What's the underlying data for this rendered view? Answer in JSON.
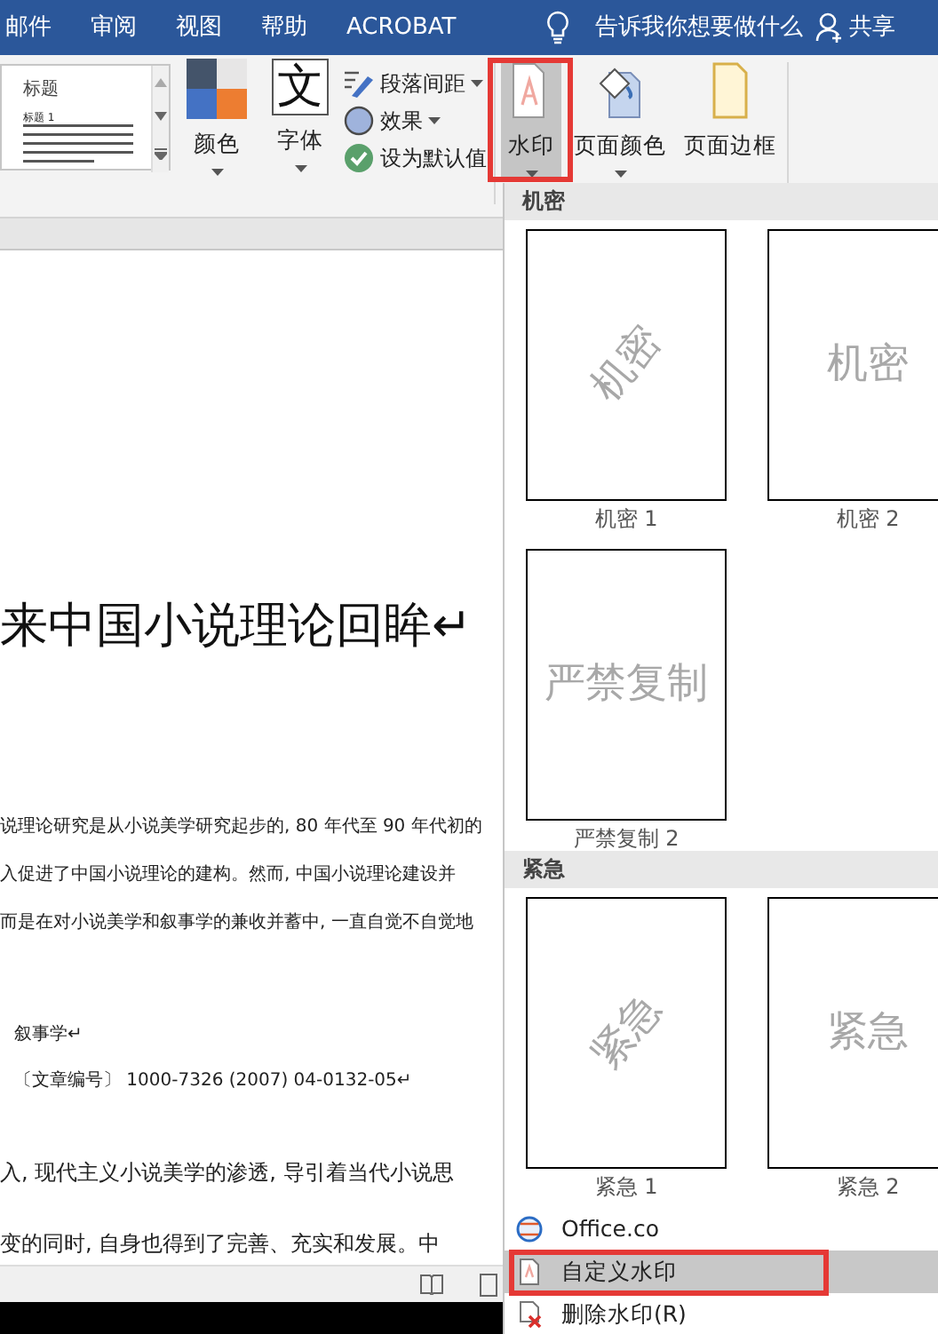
{
  "tabs": [
    {
      "label": "邮件"
    },
    {
      "label": "审阅"
    },
    {
      "label": "视图"
    },
    {
      "label": "帮助"
    },
    {
      "label": "ACROBAT"
    }
  ],
  "tell_me": "告诉我你想要做什么",
  "share": "共享",
  "styles_gallery": {
    "title": "标题",
    "subtitle": "标题 1"
  },
  "design_buttons": [
    {
      "label": "颜色",
      "kind": "colors"
    },
    {
      "label": "字体",
      "kind": "fonts",
      "glyph": "文"
    }
  ],
  "format_options": [
    {
      "label": "段落间距",
      "kind": "spacing",
      "dropdown": true
    },
    {
      "label": "效果",
      "kind": "effects",
      "dropdown": true
    },
    {
      "label": "设为默认值",
      "kind": "default",
      "dropdown": false
    }
  ],
  "page_background": [
    {
      "label": "水印",
      "kind": "watermark",
      "dropdown": true,
      "selected": true
    },
    {
      "label": "页面颜色",
      "kind": "page-color",
      "dropdown": true,
      "selected": false
    },
    {
      "label": "页面边框",
      "kind": "page-border",
      "dropdown": false,
      "selected": false
    }
  ],
  "document": {
    "title": "来中国小说理论回眸↵",
    "paragraph_lines": [
      "说理论研究是从小说美学研究起步的, 80 年代至 90 年代初的",
      "入促进了中国小说理论的建构。然而, 中国小说理论建设并",
      "而是在对小说美学和叙事学的兼收并蓄中, 一直自觉不自觉地"
    ],
    "keywords": "叙事学↵",
    "article_number": "〔文章编号〕 1000-7326 (2007) 04-0132-05↵",
    "body_lines": [
      "入, 现代主义小说美学的渗透, 导引着当代小说思",
      "变的同时, 自身也得到了完善、充实和发展。中"
    ]
  },
  "watermark_menu": {
    "sections": [
      {
        "heading": "机密",
        "items": [
          {
            "label": "机密 1",
            "text": "机密",
            "rotated": true
          },
          {
            "label": "机密 2",
            "text": "机密",
            "rotated": false
          },
          {
            "label": "严禁复制 2",
            "text": "严禁复制",
            "rotated": false
          }
        ]
      },
      {
        "heading": "紧急",
        "items": [
          {
            "label": "紧急 1",
            "text": "紧急",
            "rotated": true
          },
          {
            "label": "紧急 2",
            "text": "紧急",
            "rotated": false
          }
        ]
      }
    ],
    "commands": [
      {
        "label": "Office.co",
        "kind": "office",
        "selected": false
      },
      {
        "label": "自定义水印",
        "kind": "custom",
        "selected": true
      },
      {
        "label": "删除水印(R)",
        "kind": "remove",
        "selected": false
      }
    ]
  }
}
